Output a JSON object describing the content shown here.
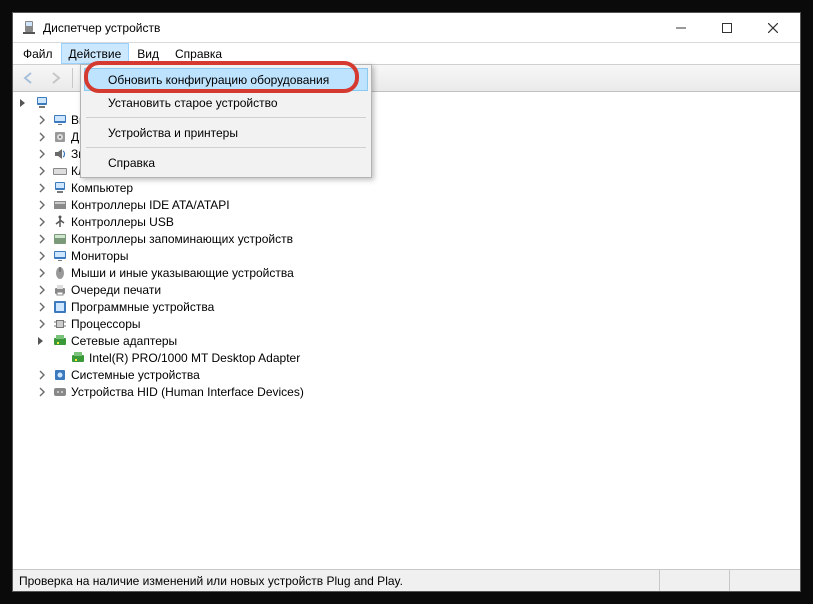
{
  "window": {
    "title": "Диспетчер устройств"
  },
  "menubar": {
    "file": "Файл",
    "action": "Действие",
    "view": "Вид",
    "help": "Справка"
  },
  "action_menu": {
    "scan": "Обновить конфигурацию оборудования",
    "legacy": "Установить старое устройство",
    "printers": "Устройства и принтеры",
    "help": "Справка"
  },
  "tree": {
    "root": "",
    "categories": [
      {
        "label": "Видеоадаптеры",
        "expanded": false,
        "icon": "display"
      },
      {
        "label": "Дисковые устройства",
        "expanded": false,
        "icon": "disk"
      },
      {
        "label": "Звуковые, игровые и видеоустройства",
        "expanded": false,
        "icon": "audio"
      },
      {
        "label": "Клавиатуры",
        "expanded": false,
        "icon": "keyboard"
      },
      {
        "label": "Компьютер",
        "expanded": false,
        "icon": "computer"
      },
      {
        "label": "Контроллеры IDE ATA/ATAPI",
        "expanded": false,
        "icon": "ide"
      },
      {
        "label": "Контроллеры USB",
        "expanded": false,
        "icon": "usb"
      },
      {
        "label": "Контроллеры запоминающих устройств",
        "expanded": false,
        "icon": "storage"
      },
      {
        "label": "Мониторы",
        "expanded": false,
        "icon": "monitor"
      },
      {
        "label": "Мыши и иные указывающие устройства",
        "expanded": false,
        "icon": "mouse"
      },
      {
        "label": "Очереди печати",
        "expanded": false,
        "icon": "printer"
      },
      {
        "label": "Программные устройства",
        "expanded": false,
        "icon": "software"
      },
      {
        "label": "Процессоры",
        "expanded": false,
        "icon": "cpu"
      },
      {
        "label": "Сетевые адаптеры",
        "expanded": true,
        "icon": "network",
        "children": [
          {
            "label": "Intel(R) PRO/1000 MT Desktop Adapter",
            "icon": "network"
          }
        ]
      },
      {
        "label": "Системные устройства",
        "expanded": false,
        "icon": "system"
      },
      {
        "label": "Устройства HID (Human Interface Devices)",
        "expanded": false,
        "icon": "hid"
      }
    ]
  },
  "status": "Проверка на наличие изменений или новых устройств Plug and Play."
}
